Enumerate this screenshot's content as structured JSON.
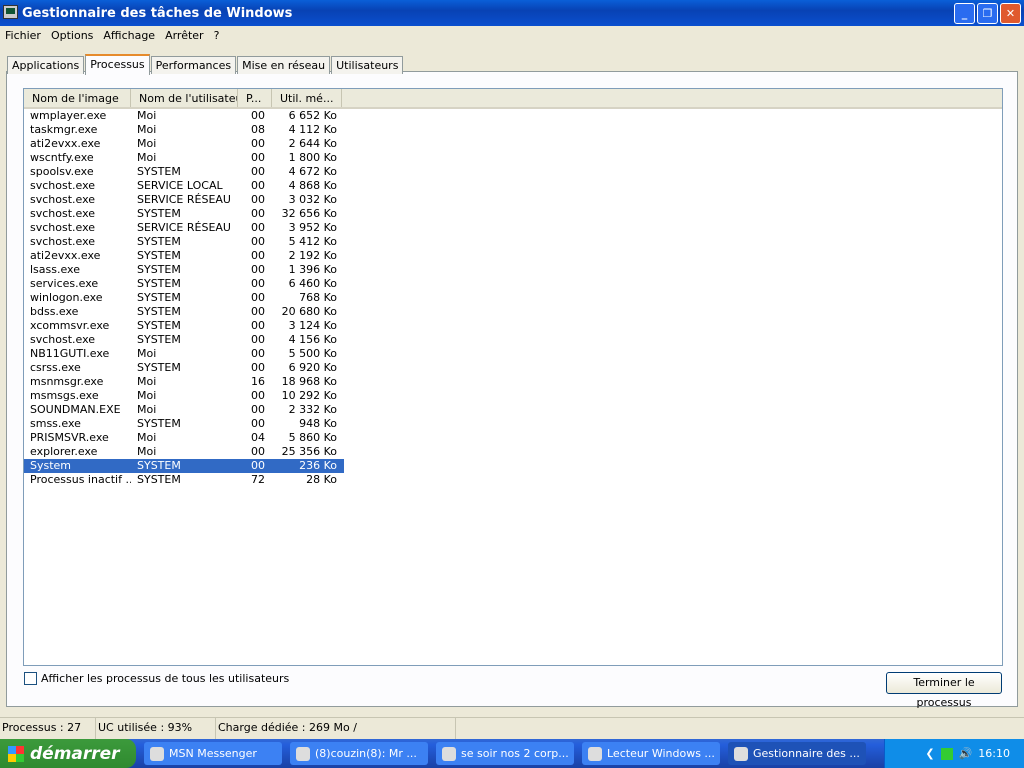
{
  "window": {
    "title": "Gestionnaire des tâches de Windows"
  },
  "menu": [
    "Fichier",
    "Options",
    "Affichage",
    "Arrêter",
    "?"
  ],
  "tabs": [
    "Applications",
    "Processus",
    "Performances",
    "Mise en réseau",
    "Utilisateurs"
  ],
  "columns": [
    "Nom de l'image",
    "Nom de l'utilisateur",
    "P...",
    "Util. mé..."
  ],
  "rows": [
    [
      "wmplayer.exe",
      "Moi",
      "00",
      "6 652 Ko"
    ],
    [
      "taskmgr.exe",
      "Moi",
      "08",
      "4 112 Ko"
    ],
    [
      "ati2evxx.exe",
      "Moi",
      "00",
      "2 644 Ko"
    ],
    [
      "wscntfy.exe",
      "Moi",
      "00",
      "1 800 Ko"
    ],
    [
      "spoolsv.exe",
      "SYSTEM",
      "00",
      "4 672 Ko"
    ],
    [
      "svchost.exe",
      "SERVICE LOCAL",
      "00",
      "4 868 Ko"
    ],
    [
      "svchost.exe",
      "SERVICE RÉSEAU",
      "00",
      "3 032 Ko"
    ],
    [
      "svchost.exe",
      "SYSTEM",
      "00",
      "32 656 Ko"
    ],
    [
      "svchost.exe",
      "SERVICE RÉSEAU",
      "00",
      "3 952 Ko"
    ],
    [
      "svchost.exe",
      "SYSTEM",
      "00",
      "5 412 Ko"
    ],
    [
      "ati2evxx.exe",
      "SYSTEM",
      "00",
      "2 192 Ko"
    ],
    [
      "lsass.exe",
      "SYSTEM",
      "00",
      "1 396 Ko"
    ],
    [
      "services.exe",
      "SYSTEM",
      "00",
      "6 460 Ko"
    ],
    [
      "winlogon.exe",
      "SYSTEM",
      "00",
      "768 Ko"
    ],
    [
      "bdss.exe",
      "SYSTEM",
      "00",
      "20 680 Ko"
    ],
    [
      "xcommsvr.exe",
      "SYSTEM",
      "00",
      "3 124 Ko"
    ],
    [
      "svchost.exe",
      "SYSTEM",
      "00",
      "4 156 Ko"
    ],
    [
      "NB11GUTI.exe",
      "Moi",
      "00",
      "5 500 Ko"
    ],
    [
      "csrss.exe",
      "SYSTEM",
      "00",
      "6 920 Ko"
    ],
    [
      "msnmsgr.exe",
      "Moi",
      "16",
      "18 968 Ko"
    ],
    [
      "msmsgs.exe",
      "Moi",
      "00",
      "10 292 Ko"
    ],
    [
      "SOUNDMAN.EXE",
      "Moi",
      "00",
      "2 332 Ko"
    ],
    [
      "smss.exe",
      "SYSTEM",
      "00",
      "948 Ko"
    ],
    [
      "PRISMSVR.exe",
      "Moi",
      "04",
      "5 860 Ko"
    ],
    [
      "explorer.exe",
      "Moi",
      "00",
      "25 356 Ko"
    ],
    [
      "System",
      "SYSTEM",
      "00",
      "236 Ko"
    ],
    [
      "Processus inactif ...",
      "SYSTEM",
      "72",
      "28 Ko"
    ]
  ],
  "selected_row": 25,
  "show_all_label": "Afficher les processus de tous les utilisateurs",
  "end_process_label": "Terminer le processus",
  "status": {
    "processes": "Processus : 27",
    "cpu": "UC utilisée : 93%",
    "commit": "Charge dédiée : 269 Mo /"
  },
  "taskbar": {
    "start": "démarrer",
    "tasks": [
      "MSN Messenger",
      "(8)couzin(8): Mr ...",
      "se soir nos 2 corp...",
      "Lecteur Windows ...",
      "Gestionnaire des ..."
    ],
    "clock": "16:10"
  }
}
